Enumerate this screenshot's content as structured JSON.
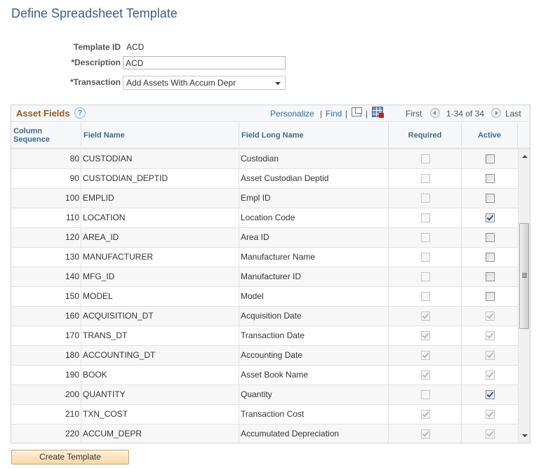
{
  "page": {
    "title": "Define Spreadsheet Template"
  },
  "form": {
    "template_id_label": "Template ID",
    "template_id_value": "ACD",
    "description_label": "*Description",
    "description_value": "ACD",
    "transaction_label": "*Transaction",
    "transaction_value": "Add Assets With Accum Depr"
  },
  "grid": {
    "title": "Asset Fields",
    "help_icon": "?",
    "personalize_label": "Personalize",
    "find_label": "Find",
    "separator": "|",
    "zoom_icon": "new-window-icon",
    "download_icon": "download-to-excel-icon",
    "first_label": "First",
    "range_text": "1-34 of 34",
    "last_label": "Last",
    "columns": {
      "seq_line1": "Column",
      "seq_line2": "Sequence",
      "field_name": "Field Name",
      "field_long_name": "Field Long Name",
      "required": "Required",
      "active": "Active"
    },
    "rows": [
      {
        "seq": "80",
        "name": "CUSTODIAN",
        "long": "Custodian",
        "required": false,
        "required_enabled": false,
        "active": false,
        "active_enabled": true
      },
      {
        "seq": "90",
        "name": "CUSTODIAN_DEPTID",
        "long": "Asset Custodian Deptid",
        "required": false,
        "required_enabled": false,
        "active": false,
        "active_enabled": true
      },
      {
        "seq": "100",
        "name": "EMPLID",
        "long": "Empl ID",
        "required": false,
        "required_enabled": false,
        "active": false,
        "active_enabled": true
      },
      {
        "seq": "110",
        "name": "LOCATION",
        "long": "Location Code",
        "required": false,
        "required_enabled": false,
        "active": true,
        "active_enabled": true
      },
      {
        "seq": "120",
        "name": "AREA_ID",
        "long": "Area ID",
        "required": false,
        "required_enabled": false,
        "active": false,
        "active_enabled": true
      },
      {
        "seq": "130",
        "name": "MANUFACTURER",
        "long": "Manufacturer Name",
        "required": false,
        "required_enabled": false,
        "active": false,
        "active_enabled": true
      },
      {
        "seq": "140",
        "name": "MFG_ID",
        "long": "Manufacturer ID",
        "required": false,
        "required_enabled": false,
        "active": false,
        "active_enabled": true
      },
      {
        "seq": "150",
        "name": "MODEL",
        "long": "Model",
        "required": false,
        "required_enabled": false,
        "active": false,
        "active_enabled": true
      },
      {
        "seq": "160",
        "name": "ACQUISITION_DT",
        "long": "Acquisition Date",
        "required": true,
        "required_enabled": false,
        "active": true,
        "active_enabled": false
      },
      {
        "seq": "170",
        "name": "TRANS_DT",
        "long": "Transaction Date",
        "required": true,
        "required_enabled": false,
        "active": true,
        "active_enabled": false
      },
      {
        "seq": "180",
        "name": "ACCOUNTING_DT",
        "long": "Accounting Date",
        "required": true,
        "required_enabled": false,
        "active": true,
        "active_enabled": false
      },
      {
        "seq": "190",
        "name": "BOOK",
        "long": "Asset Book Name",
        "required": true,
        "required_enabled": false,
        "active": true,
        "active_enabled": false
      },
      {
        "seq": "200",
        "name": "QUANTITY",
        "long": "Quantity",
        "required": false,
        "required_enabled": false,
        "active": true,
        "active_enabled": true
      },
      {
        "seq": "210",
        "name": "TXN_COST",
        "long": "Transaction Cost",
        "required": true,
        "required_enabled": false,
        "active": true,
        "active_enabled": false
      },
      {
        "seq": "220",
        "name": "ACCUM_DEPR",
        "long": "Accumulated Depreciation",
        "required": true,
        "required_enabled": false,
        "active": true,
        "active_enabled": false
      }
    ]
  },
  "actions": {
    "create_template_label": "Create Template"
  },
  "colors": {
    "title_blue": "#3d5e86",
    "grid_title_brown": "#9b5b1d",
    "link_blue": "#2a6db0",
    "header_text_blue": "#3e6a95",
    "button_fill": "#f6d8a6"
  }
}
